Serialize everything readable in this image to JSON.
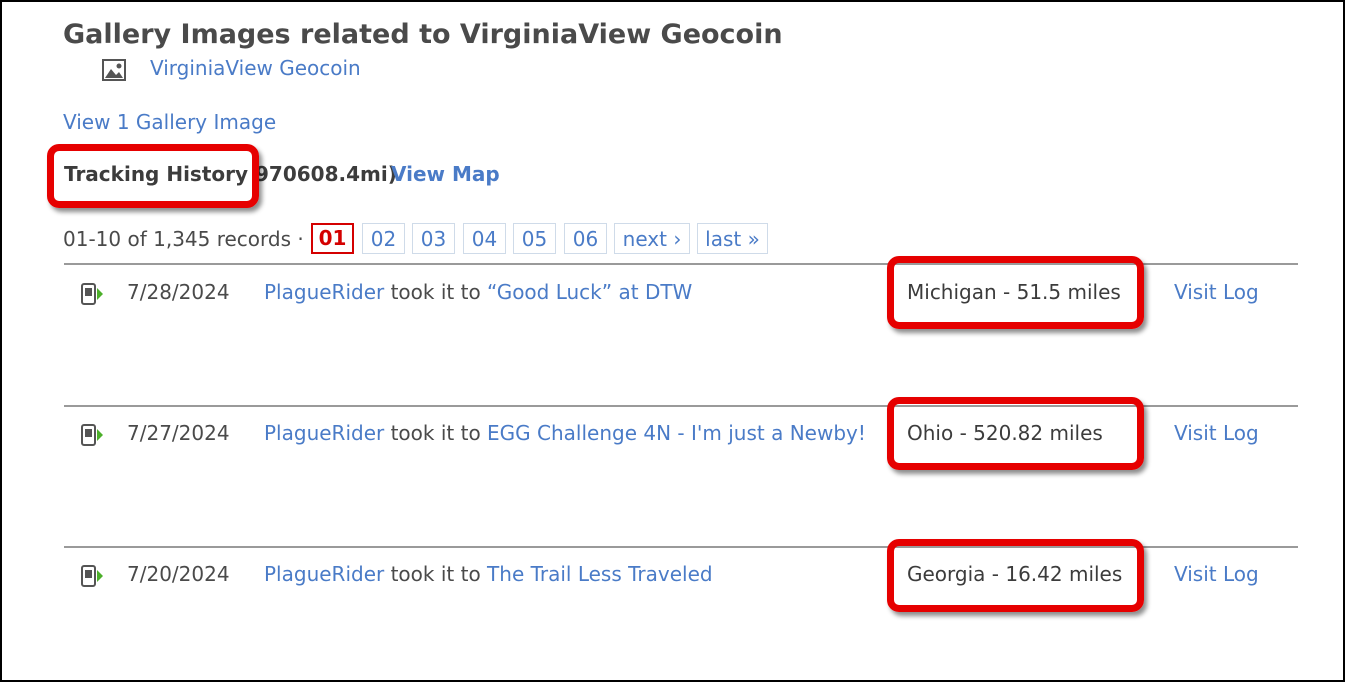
{
  "gallery": {
    "heading": "Gallery Images related to VirginiaView Geocoin",
    "item_link": "VirginiaView Geocoin",
    "item_icon": "image-icon",
    "view_link": "View 1 Gallery Image"
  },
  "tracking": {
    "label": "Tracking History",
    "distance": "970608.4mi)",
    "view_map": "View Map"
  },
  "pagination": {
    "summary": "01-10 of 1,345 records ·",
    "pages": [
      "01",
      "02",
      "03",
      "04",
      "05",
      "06"
    ],
    "current": "01",
    "next": "next ›",
    "last": "last »"
  },
  "logs": [
    {
      "icon": "dropped-off-icon",
      "date": "7/28/2024",
      "user": "PlagueRider",
      "action": "took it to",
      "cache": "“Good Luck” at DTW",
      "location": "Michigan - 51.5 miles",
      "visit": "Visit Log"
    },
    {
      "icon": "dropped-off-icon",
      "date": "7/27/2024",
      "user": "PlagueRider",
      "action": "took it to",
      "cache": "EGG Challenge 4N - I'm just a Newby!",
      "location": "Ohio - 520.82 miles",
      "visit": "Visit Log"
    },
    {
      "icon": "dropped-off-icon",
      "date": "7/20/2024",
      "user": "PlagueRider",
      "action": "took it to",
      "cache": "The Trail Less Traveled",
      "location": "Georgia - 16.42 miles",
      "visit": "Visit Log"
    }
  ],
  "colors": {
    "link": "#4a7bc7",
    "highlight": "#e60000",
    "current_page": "#d40000",
    "icon_green": "#4caf2a"
  }
}
